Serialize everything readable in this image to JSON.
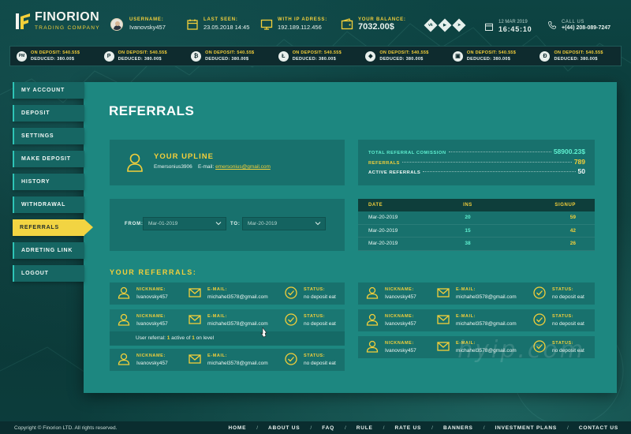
{
  "brand": {
    "name": "FINORION",
    "tagline": "TRADING COMPANY"
  },
  "header": {
    "username_label": "USERNAME:",
    "username": "Ivanovsky457",
    "last_seen_label": "LAST SEEN:",
    "last_seen": "23.05.2018 14:45",
    "ip_label": "WITH IP ADRESS:",
    "ip": "192.189.112.456",
    "balance_label": "YOUR BALANCE:",
    "balance": "7032.00$",
    "date": "12 MAR 2019",
    "time": "16:45:10",
    "call_label": "CALL US",
    "phone": "+(44) 208-089-7247",
    "social": [
      "vk",
      "youtube",
      "telegram"
    ]
  },
  "ticker": [
    {
      "icon": "PM",
      "on": "ON DEPOSIT: 540.55$",
      "off": "DEDUCED: 380.00$"
    },
    {
      "icon": "P",
      "on": "ON DEPOSIT: 540.55$",
      "off": "DEDUCED: 380.00$"
    },
    {
      "icon": "₿",
      "on": "ON DEPOSIT: 540.55$",
      "off": "DEDUCED: 380.00$"
    },
    {
      "icon": "Ł",
      "on": "ON DEPOSIT: 540.55$",
      "off": "DEDUCED: 380.00$"
    },
    {
      "icon": "◆",
      "on": "ON DEPOSIT: 540.55$",
      "off": "DEDUCED: 380.00$"
    },
    {
      "icon": "▣",
      "on": "ON DEPOSIT: 540.55$",
      "off": "DEDUCED: 380.00$"
    },
    {
      "icon": "Đ",
      "on": "ON DEPOSIT: 540.55$",
      "off": "DEDUCED: 380.00$"
    }
  ],
  "nav": [
    "MY ACCOUNT",
    "DEPOSIT",
    "SETTINGS",
    "MAKE DEPOSIT",
    "HISTORY",
    "WITHDRAWAL",
    "REFERRALS",
    "ADRETING LINK",
    "LOGOUT"
  ],
  "page": {
    "title": "REFERRALS"
  },
  "upline": {
    "title": "YOUR UPLINE",
    "name": "Emersonius3906",
    "email_label": "E-mail:",
    "email": "emersonius@gmail.com"
  },
  "totals": [
    {
      "label": "TOTAL REFERRAL COMISSION",
      "value": "58900.23$",
      "label_color": "cyan",
      "value_color": "cyan"
    },
    {
      "label": "REFERRALS",
      "value": "789",
      "label_color": "yellow",
      "value_color": "yellow"
    },
    {
      "label": "ACTIVE REFERRALS",
      "value": "50",
      "label_color": "white",
      "value_color": "white"
    }
  ],
  "filter": {
    "from_label": "FROM:",
    "from_value": "Mar-01-2019",
    "to_label": "TO:",
    "to_value": "Mar-20-2019"
  },
  "stats": {
    "headers": [
      "DATE",
      "INS",
      "SIGNUP"
    ],
    "rows": [
      [
        "Mar-20-2019",
        "20",
        "59"
      ],
      [
        "Mar-20-2019",
        "15",
        "42"
      ],
      [
        "Mar-20-2019",
        "38",
        "26"
      ]
    ]
  },
  "referrals_title": "YOUR REFERRALS:",
  "referrals": {
    "nick_label": "NICKNAME:",
    "email_label": "E-MAIL:",
    "status_label": "STATUS:",
    "items": [
      {
        "nick": "Ivanovsky457",
        "email": "michahel3578@gmail.com",
        "status": "no deposit eat"
      },
      {
        "nick": "Ivanovsky457",
        "email": "michahel3578@gmail.com",
        "status": "no deposit eat"
      },
      {
        "nick": "Ivanovsky457",
        "email": "michahel3578@gmail.com",
        "status": "no deposit eat"
      },
      {
        "nick": "Ivanovsky457",
        "email": "michahel3578@gmail.com",
        "status": "no deposit eat"
      },
      {
        "nick": "Ivanovsky457",
        "email": "michahel3578@gmail.com",
        "status": "no deposit eat"
      },
      {
        "nick": "Ivanovsky457",
        "email": "michahel3578@gmail.com",
        "status": "no deposit eat"
      }
    ],
    "expanded_note": {
      "prefix": "User referral: ",
      "active": "1",
      "mid": " active of ",
      "total": "1",
      "suffix": " on level"
    }
  },
  "watermark": "hyip.com",
  "footer": {
    "copyright": "Copyright © Finorion LTD. All rights reserved.",
    "links": [
      "HOME",
      "ABOUT US",
      "FAQ",
      "RULE",
      "RATE US",
      "BANNERS",
      "INVESTMENT PLANS",
      "CONTACT US"
    ]
  },
  "colors": {
    "accent": "#f3cf3a",
    "panel": "#1d8780",
    "card": "#18716d",
    "cyan": "#5ff0d0"
  }
}
